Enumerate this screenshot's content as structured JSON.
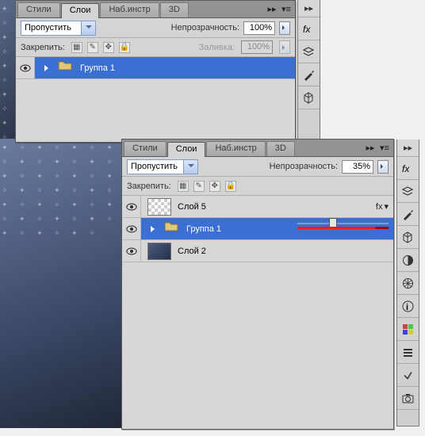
{
  "panel1": {
    "tabs": {
      "styles": "Стили",
      "layers": "Слои",
      "tools": "Наб.инстр",
      "threeD": "3D"
    },
    "blend_mode": "Пропустить",
    "opacity_label": "Непрозрачность:",
    "opacity_value": "100%",
    "lock_label": "Закрепить:",
    "fill_label": "Заливка:",
    "fill_value": "100%",
    "layers": [
      {
        "name": "Группа 1",
        "type": "group",
        "selected": true
      }
    ]
  },
  "panel2": {
    "tabs": {
      "styles": "Стили",
      "layers": "Слои",
      "tools": "Наб.инстр",
      "threeD": "3D"
    },
    "blend_mode": "Пропустить",
    "opacity_label": "Непрозрачность:",
    "opacity_value": "35%",
    "lock_label": "Закрепить:",
    "layers": [
      {
        "name": "Слой 5",
        "type": "layer",
        "hasfx": true,
        "thumb": "checker"
      },
      {
        "name": "Группа 1",
        "type": "group",
        "selected": true
      },
      {
        "name": "Слой 2",
        "type": "layer",
        "thumb": "image"
      }
    ]
  },
  "fx_label": "fx",
  "collapse_glyph": "▸▸"
}
